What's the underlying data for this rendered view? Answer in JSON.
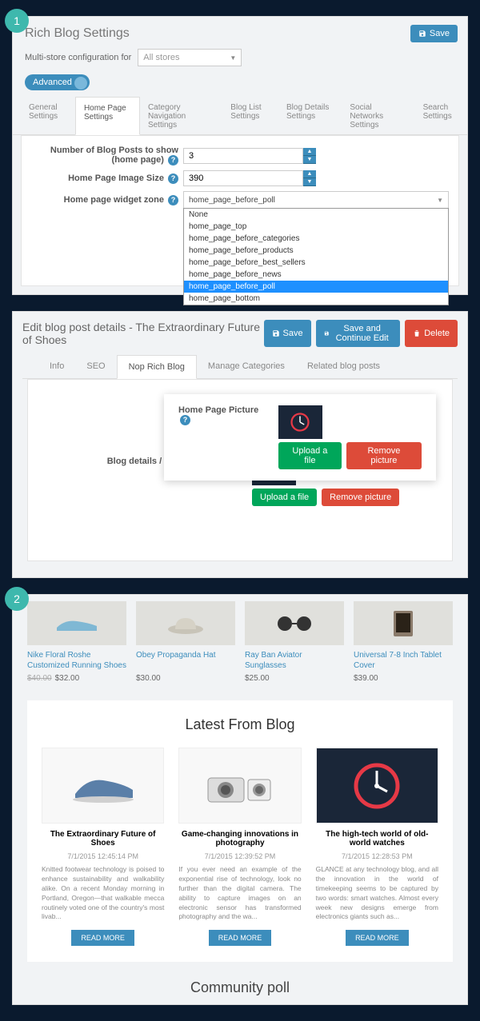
{
  "badges": {
    "one": "1",
    "two": "2"
  },
  "panel1": {
    "title": "Rich Blog Settings",
    "save": "Save",
    "multistore_label": "Multi-store configuration for",
    "multistore_value": "All stores",
    "advanced": "Advanced",
    "tabs": [
      "General Settings",
      "Home Page Settings",
      "Category Navigation Settings",
      "Blog List Settings",
      "Blog Details Settings",
      "Social Networks Settings",
      "Search Settings"
    ],
    "active_tab": 1,
    "form": {
      "num_posts_label": "Number of Blog Posts to show (home page)",
      "num_posts_value": "3",
      "img_size_label": "Home Page Image Size",
      "img_size_value": "390",
      "widget_zone_label": "Home page widget zone",
      "widget_zone_value": "home_page_before_poll",
      "widget_zone_options": [
        "None",
        "home_page_top",
        "home_page_before_categories",
        "home_page_before_products",
        "home_page_before_best_sellers",
        "home_page_before_news",
        "home_page_before_poll",
        "home_page_bottom"
      ],
      "widget_zone_selected_index": 6
    }
  },
  "panel2": {
    "title": "Edit blog post details - The Extraordinary Future of Shoes",
    "btn_save": "Save",
    "btn_save_continue": "Save and Continue Edit",
    "btn_delete": "Delete",
    "tabs": [
      "Info",
      "SEO",
      "Nop Rich Blog",
      "Manage Categories",
      "Related blog posts"
    ],
    "active_tab": 2,
    "home_pic_label": "Home Page Picture",
    "list_pic_label": "Blog details / Blog list Picture",
    "upload": "Upload a file",
    "remove": "Remove picture"
  },
  "panel3": {
    "products": [
      {
        "title": "Nike Floral Roshe Customized Running Shoes",
        "old": "$40.00",
        "price": "$32.00"
      },
      {
        "title": "Obey Propaganda Hat",
        "price": "$30.00"
      },
      {
        "title": "Ray Ban Aviator Sunglasses",
        "price": "$25.00"
      },
      {
        "title": "Universal 7-8 Inch Tablet Cover",
        "price": "$39.00"
      }
    ],
    "blog_heading": "Latest From Blog",
    "posts": [
      {
        "title": "The Extraordinary Future of Shoes",
        "date": "7/1/2015 12:45:14 PM",
        "excerpt": "Knitted footwear technology is poised to enhance sustainability and walkability alike.\nOn a recent Monday morning in Portland, Oregon—that walkable mecca routinely voted one of the country's most livab..."
      },
      {
        "title": "Game-changing innovations in photography",
        "date": "7/1/2015 12:39:52 PM",
        "excerpt": "If you ever need an example of the exponential rise of technology, look no further than the digital camera. The ability to capture images on an electronic sensor has transformed photography and the wa..."
      },
      {
        "title": "The high-tech world of old-world watches",
        "date": "7/1/2015 12:28:53 PM",
        "excerpt": "GLANCE at any technology blog, and all the innovation in the world of timekeeping seems to be captured by two words: smart watches.\nAlmost every week new designs emerge from electronics giants such as..."
      }
    ],
    "read_more": "READ MORE",
    "poll_heading": "Community poll"
  },
  "colors": {
    "accent": "#3c8dbc",
    "badge": "#3eb8ad",
    "danger": "#dd4b39",
    "success": "#00a65a",
    "highlight": "#1e90ff"
  }
}
